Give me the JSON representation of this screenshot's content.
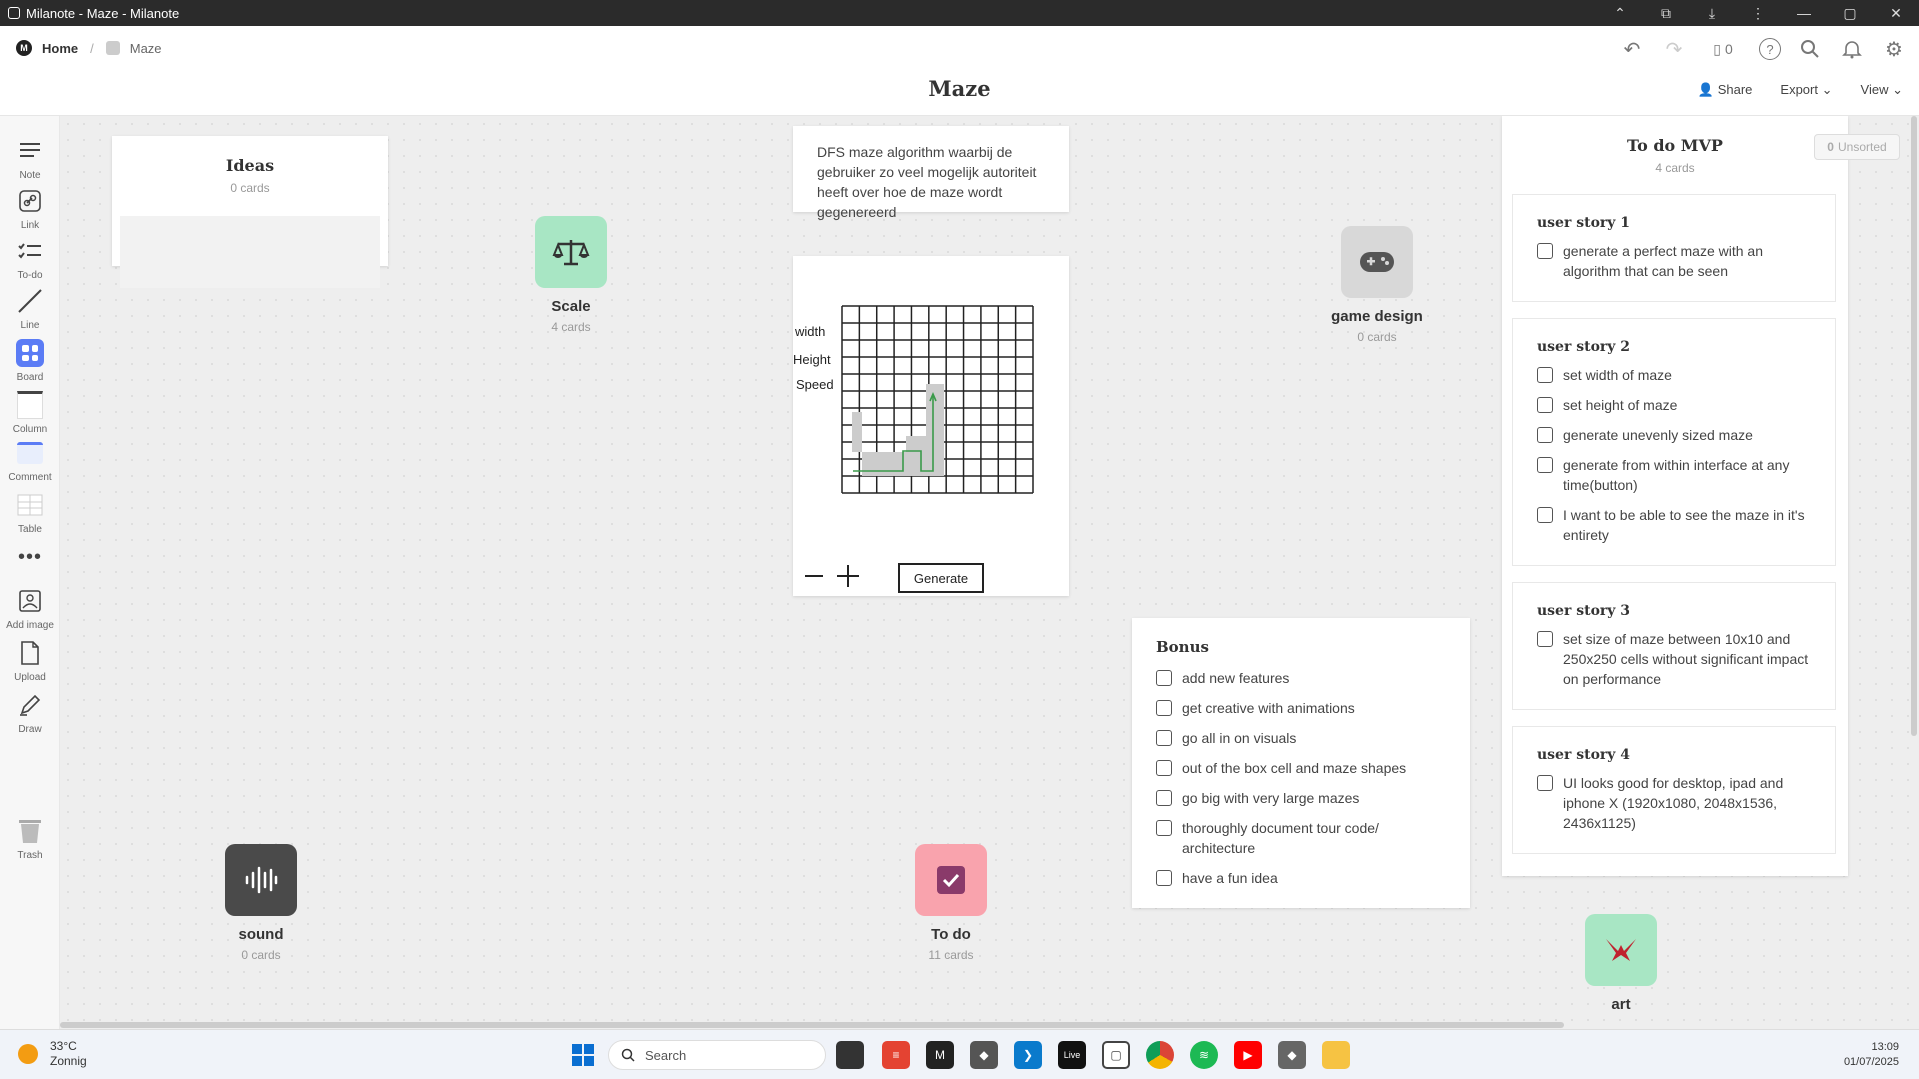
{
  "window": {
    "title": "Milanote - Maze - Milanote"
  },
  "breadcrumb": {
    "home": "Home",
    "board": "Maze"
  },
  "header": {
    "title": "Maze",
    "device_count": "0",
    "share": "Share",
    "export": "Export",
    "view": "View"
  },
  "toolbar": {
    "items": [
      {
        "label": "Note",
        "icon": "note-icon"
      },
      {
        "label": "Link",
        "icon": "link-icon"
      },
      {
        "label": "To-do",
        "icon": "todo-icon"
      },
      {
        "label": "Line",
        "icon": "line-icon"
      },
      {
        "label": "Board",
        "icon": "board-icon"
      },
      {
        "label": "Column",
        "icon": "column-icon"
      },
      {
        "label": "Comment",
        "icon": "comment-icon"
      },
      {
        "label": "Table",
        "icon": "table-icon"
      },
      {
        "label": "",
        "icon": "more-icon"
      },
      {
        "label": "Add image",
        "icon": "image-icon"
      },
      {
        "label": "Upload",
        "icon": "upload-icon"
      },
      {
        "label": "Draw",
        "icon": "draw-icon"
      },
      {
        "label": "Trash",
        "icon": "trash-icon"
      }
    ]
  },
  "ideas": {
    "title": "Ideas",
    "count": "0 cards"
  },
  "boards": {
    "scale": {
      "name": "Scale",
      "count": "4 cards",
      "color": "#a8e6c4"
    },
    "game_design": {
      "name": "game design",
      "count": "0 cards",
      "color": "#d8d8d8"
    },
    "sound": {
      "name": "sound",
      "count": "0 cards",
      "color": "#4a4a4a"
    },
    "todo": {
      "name": "To do",
      "count": "11 cards",
      "color": "#f9a3ad"
    },
    "art": {
      "name": "art",
      "count": "",
      "color": "#a8e6c4"
    }
  },
  "description_note": "DFS maze algorithm waarbij de gebruiker zo veel mogelijk autoriteit heeft over hoe de maze wordt gegenereerd",
  "sketch": {
    "labels": [
      "width",
      "Height",
      "Speed"
    ],
    "button": "Generate"
  },
  "bonus": {
    "title": "Bonus",
    "items": [
      "add new features",
      "get creative with animations",
      "go all in on visuals",
      "out of the box cell and maze shapes",
      "go big with very large mazes",
      "thoroughly document tour code/ architecture",
      "have a fun idea"
    ]
  },
  "todo_mvp": {
    "title": "To do MVP",
    "count": "4 cards",
    "unsorted_count": "0",
    "unsorted_label": "Unsorted",
    "stories": [
      {
        "title": "user story 1",
        "items": [
          "generate a perfect maze with an algorithm that can be seen"
        ]
      },
      {
        "title": "user story 2",
        "items": [
          "set width of maze",
          "set height of maze",
          "generate unevenly sized maze",
          "generate from within interface at any time(button)",
          "I want to be able to see the maze in it's entirety"
        ]
      },
      {
        "title": "user story 3",
        "items": [
          "set size of maze between 10x10 and 250x250 cells without significant impact on performance"
        ]
      },
      {
        "title": "user story 4",
        "items": [
          "UI looks good for desktop, ipad and iphone X (1920x1080, 2048x1536, 2436x1125)"
        ]
      }
    ]
  },
  "taskbar": {
    "weather_temp": "33°C",
    "weather_desc": "Zonnig",
    "search": "Search",
    "time": "13:09",
    "date": "01/07/2025"
  }
}
